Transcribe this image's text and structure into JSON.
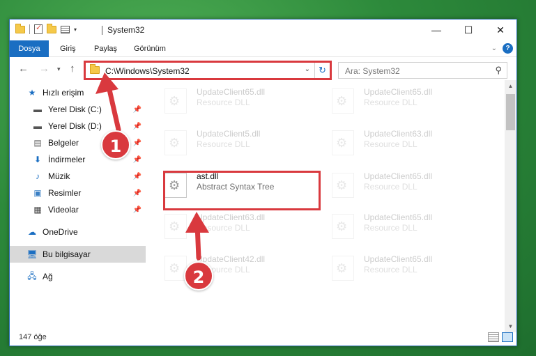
{
  "window": {
    "title": "System32"
  },
  "ribbon": {
    "tabs": [
      "Dosya",
      "Giriş",
      "Paylaş",
      "Görünüm"
    ]
  },
  "address": {
    "path": "C:\\Windows\\System32"
  },
  "search": {
    "placeholder": "Ara: System32"
  },
  "nav": {
    "items": [
      {
        "label": "Hızlı erişim",
        "icon": "star-icon",
        "pinned": false
      },
      {
        "label": "Yerel Disk (C:)",
        "icon": "drive-icon",
        "pinned": true
      },
      {
        "label": "Yerel Disk (D:)",
        "icon": "drive-icon",
        "pinned": true
      },
      {
        "label": "Belgeler",
        "icon": "documents-icon",
        "pinned": true
      },
      {
        "label": "İndirmeler",
        "icon": "download-icon",
        "pinned": true
      },
      {
        "label": "Müzik",
        "icon": "music-icon",
        "pinned": true
      },
      {
        "label": "Resimler",
        "icon": "pictures-icon",
        "pinned": true
      },
      {
        "label": "Videolar",
        "icon": "video-icon",
        "pinned": true
      },
      {
        "label": "OneDrive",
        "icon": "cloud-icon",
        "pinned": false
      },
      {
        "label": "Bu bilgisayar",
        "icon": "computer-icon",
        "pinned": false
      },
      {
        "label": "Ağ",
        "icon": "network-icon",
        "pinned": false
      }
    ]
  },
  "files": [
    {
      "name": "UpdateClient65.dll",
      "desc": "Resource DLL",
      "faded": true
    },
    {
      "name": "UpdateClient65.dll",
      "desc": "Resource DLL",
      "faded": true
    },
    {
      "name": "UpdateClient5.dll",
      "desc": "Resource DLL",
      "faded": true
    },
    {
      "name": "UpdateClient63.dll",
      "desc": "Resource DLL",
      "faded": true
    },
    {
      "name": "ast.dll",
      "desc": "Abstract Syntax Tree",
      "faded": false
    },
    {
      "name": "UpdateClient65.dll",
      "desc": "Resource DLL",
      "faded": true
    },
    {
      "name": "UpdateClient63.dll",
      "desc": "Resource DLL",
      "faded": true
    },
    {
      "name": "UpdateClient65.dll",
      "desc": "Resource DLL",
      "faded": true
    },
    {
      "name": "UpdateClient42.dll",
      "desc": "Resource DLL",
      "faded": true
    },
    {
      "name": "UpdateClient65.dll",
      "desc": "Resource DLL",
      "faded": true
    }
  ],
  "status": {
    "count": "147 öğe"
  },
  "callouts": [
    "1",
    "2"
  ],
  "colors": {
    "accent": "#1a6ec2",
    "highlight": "#d9393e",
    "background": "#2e8a3c"
  }
}
